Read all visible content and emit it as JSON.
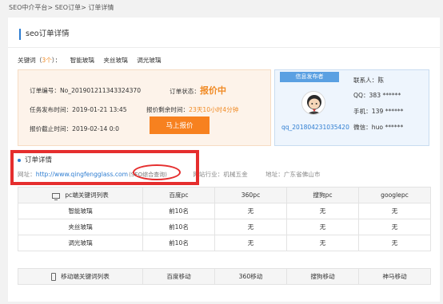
{
  "breadcrumb": "SEO中介平台> SEO订单> 订单详情",
  "panel_title": "seo订单详情",
  "keywords": {
    "label": "关键词（",
    "count": "3个",
    "close": "）：",
    "items": [
      "智能玻璃",
      "夹丝玻璃",
      "调光玻璃"
    ]
  },
  "order": {
    "number_label": "订单编号：",
    "number": "No_20190121134332437‌0",
    "status_label": "订单状态：",
    "status": "报价中",
    "publish_label": "任务发布时间：",
    "publish_time": "2019-01-21 13:45",
    "remain_label": "报价剩余时间：",
    "remain": "23天10小时4分钟",
    "deadline_label": "报价截止时间：",
    "deadline": "2019-02-14 0:0",
    "quote_button": "马上报价"
  },
  "publisher": {
    "header": "信息发布者",
    "contact": "联系人：陈",
    "qq": "QQ：383 ******",
    "phone": "手机：139 ******",
    "wechat": "微信：huo ******",
    "qq_no": "qq_20180423103542‌0"
  },
  "detail": {
    "title": "订单详情",
    "site_label": "网址：",
    "url": "http://www.qingfengglass.com",
    "seo_link": "(SEO综合查询)",
    "industry": "网站行业：机械五金",
    "address": "地址：广东省佛山市"
  },
  "pc_table": {
    "headers": [
      "pc端关键词列表",
      "百度pc",
      "360pc",
      "搜狗pc",
      "googlepc"
    ],
    "rows": [
      [
        "智能玻璃",
        "前10名",
        "无",
        "无",
        "无"
      ],
      [
        "夹丝玻璃",
        "前10名",
        "无",
        "无",
        "无"
      ],
      [
        "调光玻璃",
        "前10名",
        "无",
        "无",
        "无"
      ]
    ]
  },
  "mobile_table": {
    "headers": [
      "移动端关键词列表",
      "百度移动",
      "360移动",
      "搜狗移动",
      "神马移动"
    ]
  },
  "colors": {
    "accent_blue": "#2e7dd1",
    "accent_orange": "#f08a24",
    "annotation_red": "#e52e2e"
  },
  "icons": [
    "monitor-icon",
    "phone-icon",
    "user-avatar-icon"
  ]
}
